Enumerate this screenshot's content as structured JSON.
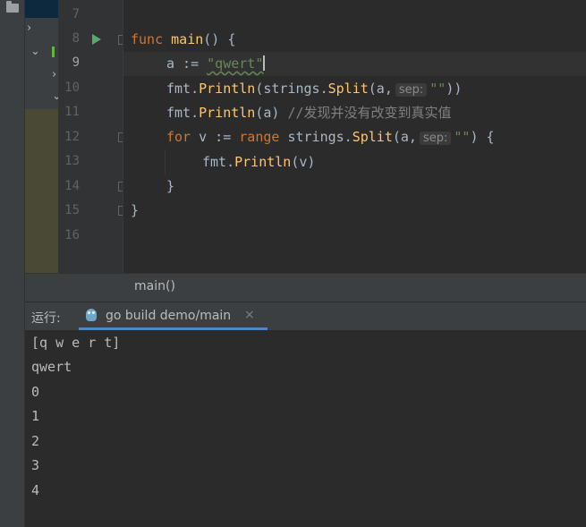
{
  "editor": {
    "line_numbers": [
      "7",
      "8",
      "9",
      "10",
      "11",
      "12",
      "13",
      "14",
      "15",
      "16"
    ],
    "lines": {
      "l8": {
        "kw": "func",
        "name": "main",
        "rest": "() {"
      },
      "l9": {
        "var": "a := ",
        "str": "\"qwert\""
      },
      "l10": {
        "pre": "fmt.",
        "fn1": "Println",
        "mid": "(strings.",
        "fn2": "Split",
        "args": "(a,",
        "hint": "sep:",
        "str": "\"\"",
        "post": "))"
      },
      "l11": {
        "pre": "fmt.",
        "fn": "Println",
        "args": "(a) ",
        "comment": "//发现并没有改变到真实值"
      },
      "l12": {
        "kw1": "for",
        "mid": " v := ",
        "kw2": "range",
        "mid2": " strings.",
        "fn": "Split",
        "args": "(a,",
        "hint": "sep:",
        "str": "\"\"",
        "post": ") {"
      },
      "l13": {
        "pre": "fmt.",
        "fn": "Println",
        "args": "(v)"
      },
      "l14": {
        "text": "}"
      },
      "l15": {
        "text": "}"
      }
    }
  },
  "breadcrumb": "main()",
  "run": {
    "label": "运行:",
    "tab_label": "go build demo/main",
    "close_glyph": "×"
  },
  "console": [
    "[q w e r t]",
    "qwert",
    "0",
    "1",
    "2",
    "3",
    "4"
  ]
}
